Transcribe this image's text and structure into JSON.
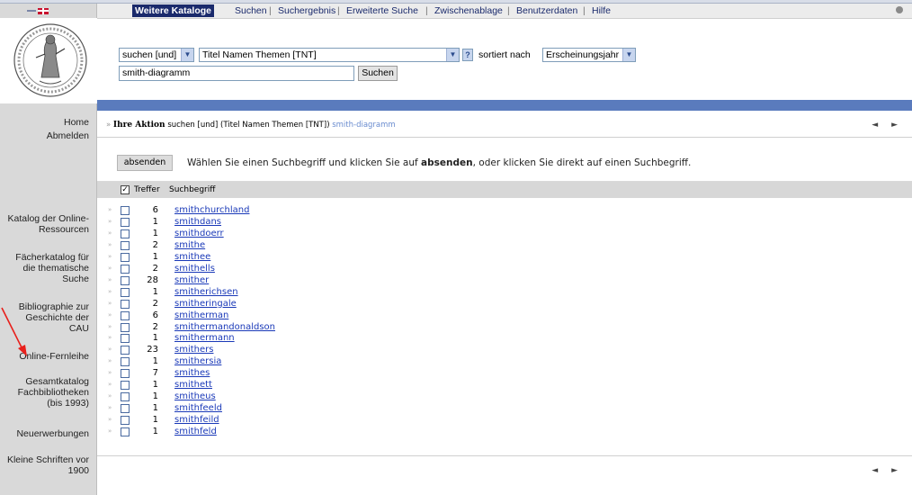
{
  "header": {
    "tabs": [
      {
        "label": "Weitere Kataloge",
        "active": true
      },
      {
        "label": "Suchen"
      },
      {
        "label": "Suchergebnis"
      },
      {
        "label": "Erweiterte Suche"
      },
      {
        "label": "Zwischenablage"
      },
      {
        "label": "Benutzerdaten"
      },
      {
        "label": "Hilfe"
      }
    ],
    "separator": "|"
  },
  "search": {
    "operator_select": "suchen [und]",
    "field_select": "Titel Namen Themen [TNT]",
    "help_label": "?",
    "sort_label": "sortiert nach",
    "sort_select": "Erscheinungsjahr",
    "query_value": "smith-diagramm",
    "submit_label": "Suchen"
  },
  "sidebar": {
    "home": "Home",
    "logout": "Abmelden",
    "items": [
      [
        "Katalog der Online-",
        "Ressourcen"
      ],
      [
        "Fächerkatalog für",
        "die thematische",
        "Suche"
      ],
      [
        "Bibliographie zur",
        "Geschichte der",
        "CAU"
      ],
      [
        "Online-Fernleihe"
      ],
      [
        "Gesamtkatalog",
        "Fachbibliotheken",
        "(bis 1993)"
      ],
      [
        "Neuerwerbungen"
      ],
      [
        "Kleine Schriften vor",
        "1900"
      ]
    ]
  },
  "action": {
    "label": "Ihre Aktion",
    "description": "suchen [und] (Titel Namen Themen [TNT])",
    "term": "smith-diagramm",
    "pager": "◄ ►"
  },
  "instruction": {
    "button": "absenden",
    "text_before": "Wählen Sie einen Suchbegriff und klicken Sie auf",
    "text_bold": "absenden",
    "text_after": ", oder klicken Sie direkt auf einen Suchbegriff."
  },
  "table": {
    "col_treffer": "Treffer",
    "col_suchbegriff": "Suchbegriff",
    "rows": [
      {
        "count": "6",
        "term": "smithchurchland"
      },
      {
        "count": "1",
        "term": "smithdans"
      },
      {
        "count": "1",
        "term": "smithdoerr"
      },
      {
        "count": "2",
        "term": "smithe"
      },
      {
        "count": "1",
        "term": "smithee"
      },
      {
        "count": "2",
        "term": "smithells"
      },
      {
        "count": "28",
        "term": "smither"
      },
      {
        "count": "1",
        "term": "smitherichsen"
      },
      {
        "count": "2",
        "term": "smitheringale"
      },
      {
        "count": "6",
        "term": "smitherman"
      },
      {
        "count": "2",
        "term": "smithermandonaldson"
      },
      {
        "count": "1",
        "term": "smithermann"
      },
      {
        "count": "23",
        "term": "smithers"
      },
      {
        "count": "1",
        "term": "smithersia"
      },
      {
        "count": "7",
        "term": "smithes"
      },
      {
        "count": "1",
        "term": "smithett"
      },
      {
        "count": "1",
        "term": "smitheus"
      },
      {
        "count": "1",
        "term": "smithfeeld"
      },
      {
        "count": "1",
        "term": "smithfeild"
      },
      {
        "count": "1",
        "term": "smithfeld"
      }
    ]
  },
  "colors": {
    "accent_bar": "#5a7bbd",
    "active_tab": "#1a2a6c",
    "link": "#1a39b8",
    "annotation_arrow": "#e8201c"
  }
}
